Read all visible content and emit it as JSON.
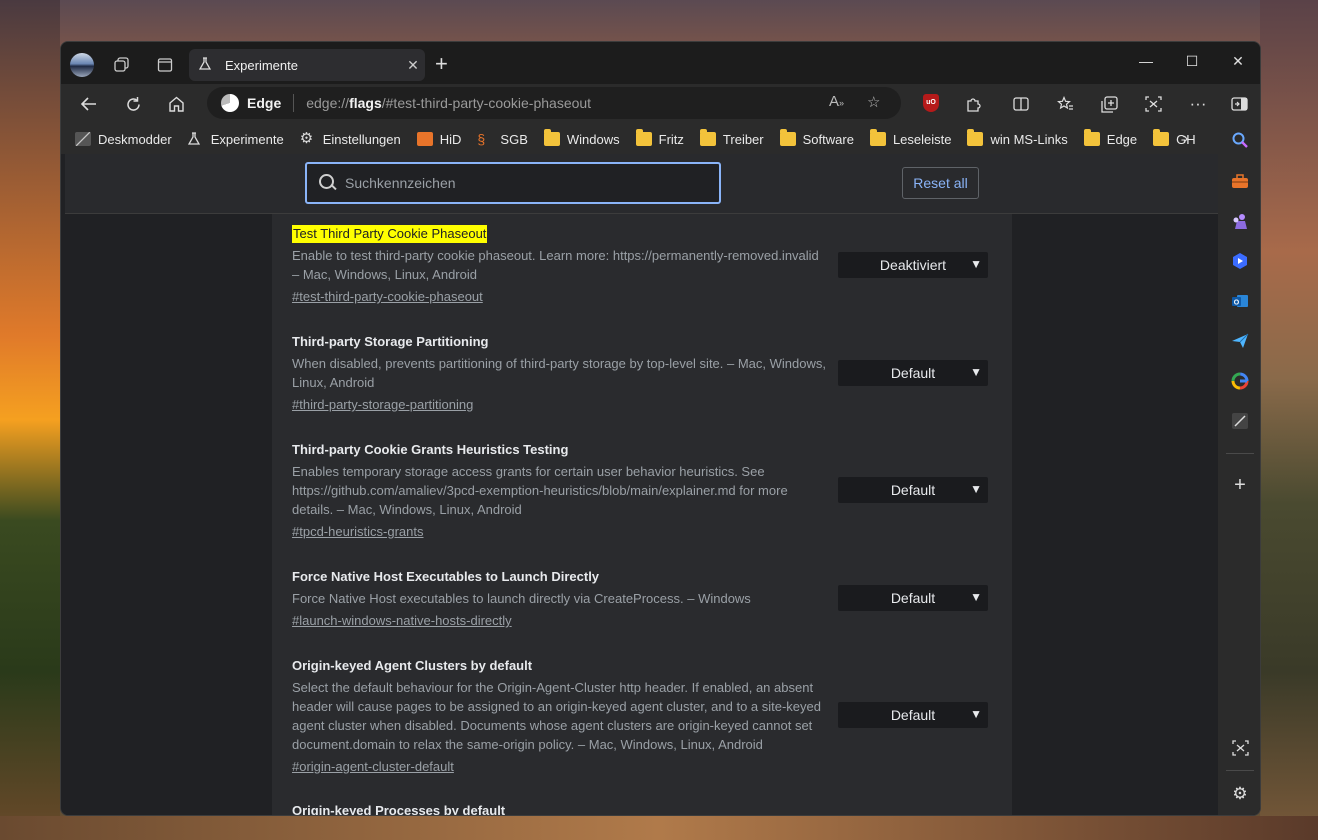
{
  "tab": {
    "title": "Experimente",
    "close": "✕"
  },
  "window_controls": {
    "minimize": "—",
    "maximize": "☐",
    "close": "✕"
  },
  "address": {
    "label": "Edge",
    "url_prefix": "edge://",
    "url_bold": "flags",
    "url_rest": "/#test-third-party-cookie-phaseout"
  },
  "favorites": [
    {
      "label": "Deskmodder",
      "icon": "deskmodder-icon"
    },
    {
      "label": "Experimente",
      "icon": "flask-icon"
    },
    {
      "label": "Einstellungen",
      "icon": "gear-icon"
    },
    {
      "label": "HiD",
      "icon": "hid-icon"
    },
    {
      "label": "SGB",
      "icon": "sgb-icon"
    },
    {
      "label": "Windows",
      "icon": "folder-icon"
    },
    {
      "label": "Fritz",
      "icon": "folder-icon"
    },
    {
      "label": "Treiber",
      "icon": "folder-icon"
    },
    {
      "label": "Software",
      "icon": "folder-icon"
    },
    {
      "label": "Leseleiste",
      "icon": "folder-icon"
    },
    {
      "label": "win MS-Links",
      "icon": "folder-icon"
    },
    {
      "label": "Edge",
      "icon": "folder-icon"
    },
    {
      "label": "GH",
      "icon": "folder-icon"
    }
  ],
  "search": {
    "placeholder": "Suchkennzeichen"
  },
  "reset_label": "Reset all",
  "flags": [
    {
      "title": "Test Third Party Cookie Phaseout",
      "desc": "Enable to test third-party cookie phaseout. Learn more: https://permanently-removed.invalid – Mac, Windows, Linux, Android",
      "link": "#test-third-party-cookie-phaseout",
      "value": "Deaktiviert"
    },
    {
      "title": "Third-party Storage Partitioning",
      "desc": "When disabled, prevents partitioning of third-party storage by top-level site. – Mac, Windows, Linux, Android",
      "link": "#third-party-storage-partitioning",
      "value": "Default"
    },
    {
      "title": "Third-party Cookie Grants Heuristics Testing",
      "desc": "Enables temporary storage access grants for certain user behavior heuristics. See https://github.com/amaliev/3pcd-exemption-heuristics/blob/main/explainer.md for more details. – Mac, Windows, Linux, Android",
      "link": "#tpcd-heuristics-grants",
      "value": "Default"
    },
    {
      "title": "Force Native Host Executables to Launch Directly",
      "desc": "Force Native Host executables to launch directly via CreateProcess. – Windows",
      "link": "#launch-windows-native-hosts-directly",
      "value": "Default"
    },
    {
      "title": "Origin-keyed Agent Clusters by default",
      "desc": "Select the default behaviour for the Origin-Agent-Cluster http header. If enabled, an absent header will cause pages to be assigned to an origin-keyed agent cluster, and to a site-keyed agent cluster when disabled. Documents whose agent clusters are origin-keyed cannot set document.domain to relax the same-origin policy. – Mac, Windows, Linux, Android",
      "link": "#origin-agent-cluster-default",
      "value": "Default"
    },
    {
      "title": "Origin-keyed Processes by default",
      "desc": "",
      "link": "",
      "value": ""
    }
  ]
}
